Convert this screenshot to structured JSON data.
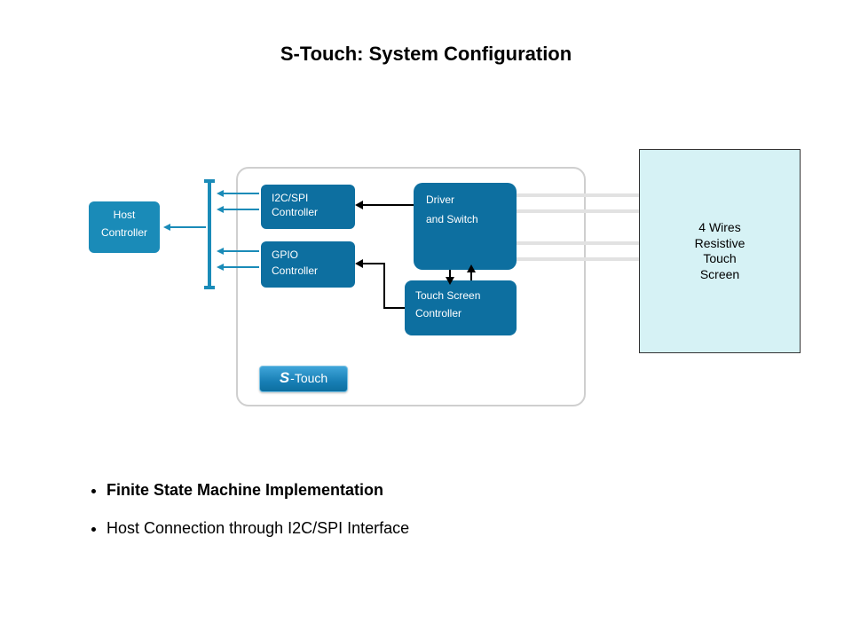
{
  "title": "S-Touch: System Configuration",
  "blocks": {
    "host": {
      "l1": "Host",
      "l2": "Controller"
    },
    "i2c": {
      "l1": "I2C/SPI",
      "l2": "Controller"
    },
    "gpio": {
      "l1": "GPIO",
      "l2": "Controller"
    },
    "driver": {
      "l1": "Driver",
      "l2": "and Switch"
    },
    "tsc": {
      "l1": "Touch Screen",
      "l2": "Controller"
    },
    "panel": {
      "l1": "4 Wires",
      "l2": "Resistive",
      "l3": "Touch",
      "l4": "Screen"
    }
  },
  "badge": {
    "prefix": "S",
    "suffix": "-Touch"
  },
  "bullets": [
    "Finite State Machine Implementation",
    "Host Connection through I2C/SPI Interface"
  ]
}
